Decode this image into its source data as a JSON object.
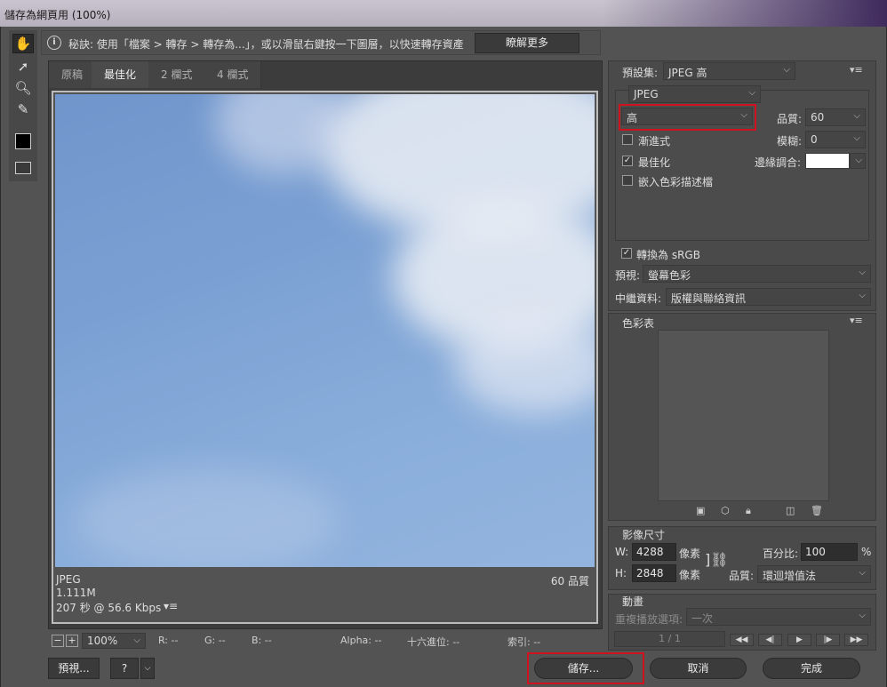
{
  "window": {
    "title": "儲存為網頁用 (100%)"
  },
  "tip": {
    "text": "秘訣: 使用「檔案 > 轉存 > 轉存為...」，或以滑鼠右鍵按一下圖層，以快速轉存資產",
    "learn_more": "瞭解更多"
  },
  "tabs": [
    {
      "label": "原稿"
    },
    {
      "label": "最佳化"
    },
    {
      "label": "2 欄式"
    },
    {
      "label": "4 欄式"
    }
  ],
  "image_info": {
    "format": "JPEG",
    "size": "1.111M",
    "time": "207 秒 @ 56.6 Kbps",
    "quality": "60 品質"
  },
  "status": {
    "zoom": "100%",
    "r": "R: --",
    "g": "G: --",
    "b": "B: --",
    "alpha": "Alpha: --",
    "hex": "十六進位: --",
    "index": "索引: --"
  },
  "buttons": {
    "preview": "預視...",
    "save": "儲存...",
    "cancel": "取消",
    "done": "完成"
  },
  "settings": {
    "preset_label": "預設集:",
    "preset_value": "JPEG 高",
    "format": "JPEG",
    "quality_preset": "高",
    "quality_label": "品質:",
    "quality_value": "60",
    "blur_label": "模糊:",
    "blur_value": "0",
    "progressive": "漸進式",
    "optimized": "最佳化",
    "embed_profile": "嵌入色彩描述檔",
    "matte_label": "邊緣調合:",
    "convert_srgb": "轉換為 sRGB",
    "preview_label": "預視:",
    "preview_value": "螢幕色彩",
    "metadata_label": "中繼資料:",
    "metadata_value": "版權與聯絡資訊"
  },
  "color_table": {
    "title": "色彩表"
  },
  "image_size": {
    "title": "影像尺寸",
    "w_label": "W:",
    "w_value": "4288",
    "h_label": "H:",
    "h_value": "2848",
    "unit": "像素",
    "percent_label": "百分比:",
    "percent_value": "100",
    "percent_sign": "%",
    "quality_label": "品質:",
    "quality_value": "環迴增值法"
  },
  "animation": {
    "title": "動畫",
    "loop_label": "重複播放選項:",
    "loop_value": "一次",
    "frame": "1 / 1"
  },
  "colors": {
    "highlight": "#d0121e",
    "sky": "#7aa0d3"
  }
}
